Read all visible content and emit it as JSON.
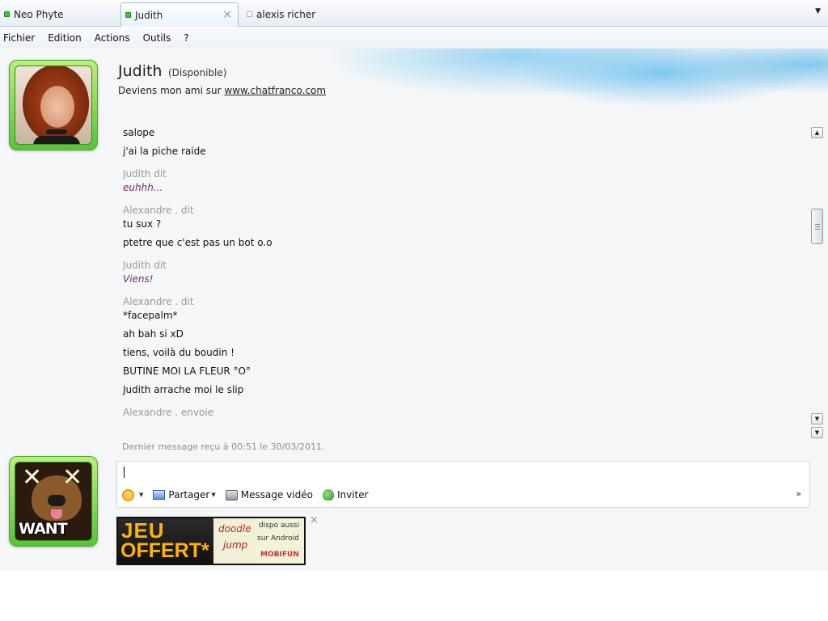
{
  "tabs": [
    {
      "label": "Neo Phyte",
      "status": "online"
    },
    {
      "label": "Judith",
      "status": "online",
      "active": true
    },
    {
      "label": "alexis richer",
      "status": "offline"
    }
  ],
  "tab_close_glyph": "×",
  "tab_menu_glyph": "▼",
  "menu": [
    "Fichier",
    "Edition",
    "Actions",
    "Outils",
    "?"
  ],
  "contact": {
    "name": "Judith",
    "status": "(Disponible)",
    "message_prefix": "Deviens mon ami sur ",
    "message_link": "www.chatfranco.com"
  },
  "conversation": [
    {
      "kind": "text",
      "text": "salope"
    },
    {
      "kind": "text",
      "text": "j'ai la piche raide"
    },
    {
      "kind": "sender",
      "text": "Judith dit"
    },
    {
      "kind": "incoming",
      "text": "euhhh..."
    },
    {
      "kind": "sender",
      "text": "Alexandre . dit"
    },
    {
      "kind": "text",
      "text": "tu sux ?"
    },
    {
      "kind": "text",
      "text": "ptetre que c'est pas un bot o.o"
    },
    {
      "kind": "sender",
      "text": "Judith dit"
    },
    {
      "kind": "incoming",
      "text": "Viens!"
    },
    {
      "kind": "sender",
      "text": "Alexandre . dit"
    },
    {
      "kind": "text",
      "text": "*facepalm*"
    },
    {
      "kind": "text",
      "text": "ah bah si xD"
    },
    {
      "kind": "text",
      "text": "tiens, voilà du boudin !"
    },
    {
      "kind": "text",
      "text": "BUTINE MOI LA FLEUR °O°"
    },
    {
      "kind": "text",
      "text": "Judith arrache moi le slip"
    },
    {
      "kind": "sender",
      "text": "Alexandre . envoie"
    }
  ],
  "last_message": "Dernier message reçu à 00:51 le 30/03/2011.",
  "compose": {
    "value": "",
    "share_label": "Partager",
    "video_label": "Message vidéo",
    "invite_label": "Inviter",
    "more_glyph": "»",
    "dropdown_glyph": "▼"
  },
  "user_avatar_caption": "WANT",
  "ad": {
    "line1": "JEU",
    "line2": "OFFERT*",
    "doodle1": "doodle",
    "doodle2": "jump",
    "right1": "dispo aussi",
    "right2": "sur Android",
    "brand": "MOBIFUN",
    "close_glyph": "×"
  },
  "scrollbar": {
    "up_glyph": "▲",
    "down_glyph": "▼",
    "end_glyph": "▼"
  },
  "colors": {
    "incoming_text": "#7a2c6e",
    "sender_text": "#9a9a9a",
    "avatar_frame": "#56c43a",
    "status_online": "#3cc43c"
  }
}
